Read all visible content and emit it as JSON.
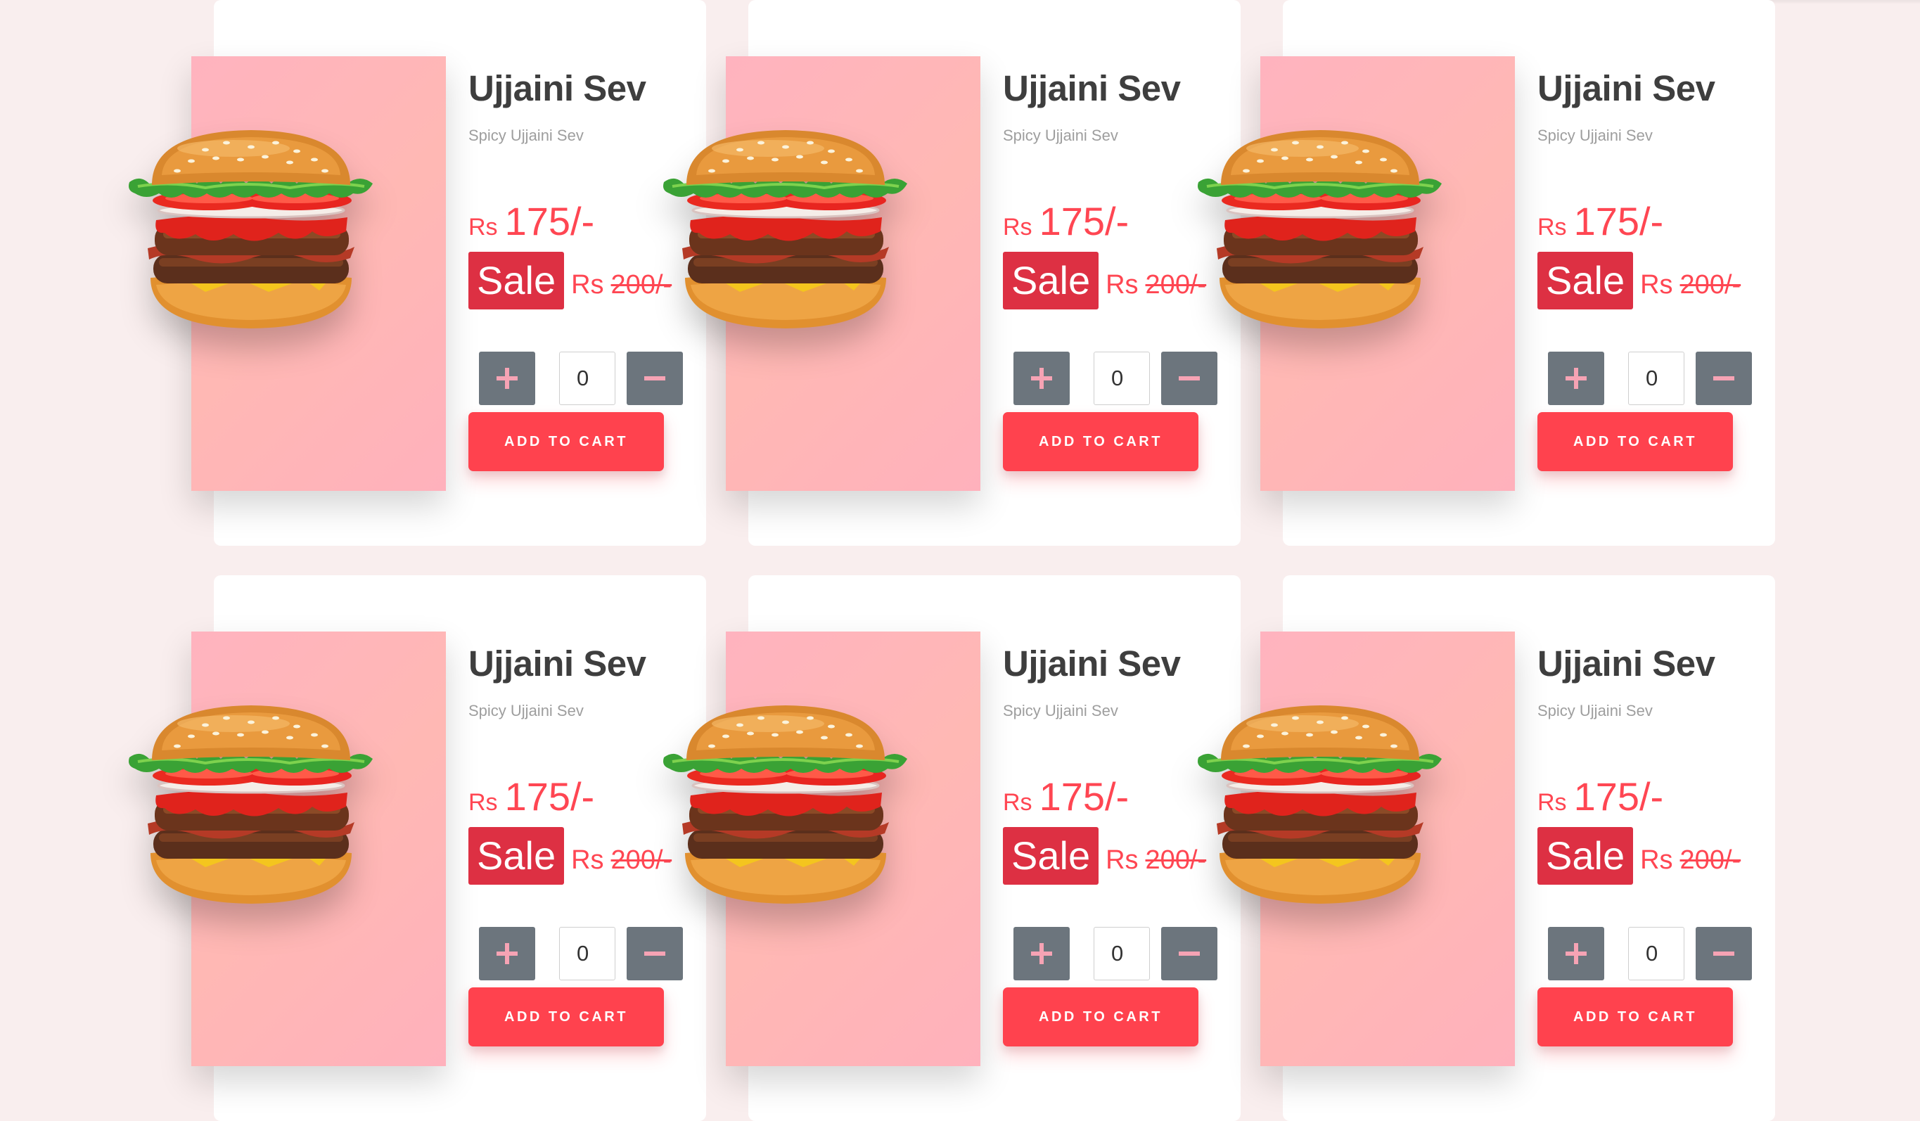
{
  "products": [
    {
      "name": "Ujjaini Sev",
      "description": "Spicy Ujjaini Sev",
      "currency": "Rs",
      "price": "175/-",
      "sale_label": "Sale",
      "old_currency": "Rs",
      "old_price": "200/-",
      "quantity": "0",
      "add_to_cart_label": "ADD TO CART",
      "image_icon": "burger-icon"
    },
    {
      "name": "Ujjaini Sev",
      "description": "Spicy Ujjaini Sev",
      "currency": "Rs",
      "price": "175/-",
      "sale_label": "Sale",
      "old_currency": "Rs",
      "old_price": "200/-",
      "quantity": "0",
      "add_to_cart_label": "ADD TO CART",
      "image_icon": "burger-icon"
    },
    {
      "name": "Ujjaini Sev",
      "description": "Spicy Ujjaini Sev",
      "currency": "Rs",
      "price": "175/-",
      "sale_label": "Sale",
      "old_currency": "Rs",
      "old_price": "200/-",
      "quantity": "0",
      "add_to_cart_label": "ADD TO CART",
      "image_icon": "burger-icon"
    },
    {
      "name": "Ujjaini Sev",
      "description": "Spicy Ujjaini Sev",
      "currency": "Rs",
      "price": "175/-",
      "sale_label": "Sale",
      "old_currency": "Rs",
      "old_price": "200/-",
      "quantity": "0",
      "add_to_cart_label": "ADD TO CART",
      "image_icon": "burger-icon"
    },
    {
      "name": "Ujjaini Sev",
      "description": "Spicy Ujjaini Sev",
      "currency": "Rs",
      "price": "175/-",
      "sale_label": "Sale",
      "old_currency": "Rs",
      "old_price": "200/-",
      "quantity": "0",
      "add_to_cart_label": "ADD TO CART",
      "image_icon": "burger-icon"
    },
    {
      "name": "Ujjaini Sev",
      "description": "Spicy Ujjaini Sev",
      "currency": "Rs",
      "price": "175/-",
      "sale_label": "Sale",
      "old_currency": "Rs",
      "old_price": "200/-",
      "quantity": "0",
      "add_to_cart_label": "ADD TO CART",
      "image_icon": "burger-icon"
    }
  ],
  "icons": {
    "increment": "plus-icon",
    "decrement": "minus-icon"
  },
  "colors": {
    "page_background": "#f9eeee",
    "card_background": "#ffffff",
    "accent_red": "#ff424e",
    "price_red": "#ff4652",
    "sale_badge": "#dd3043",
    "stepper_button": "#6c757d",
    "stepper_glyph": "#f6a3b4",
    "image_panel_pink": "#ffb3bf",
    "title_text": "#3e3e3e",
    "muted_text": "#9e9e9e"
  }
}
